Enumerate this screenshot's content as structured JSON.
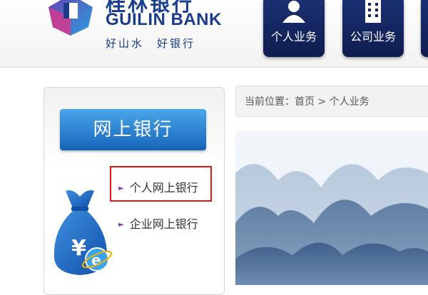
{
  "header": {
    "logo_cn": "桂林银行",
    "logo_en": "GUILIN BANK",
    "slogan": "好山水　好银行",
    "nav": [
      {
        "label": "个人业务",
        "icon": "person-icon"
      },
      {
        "label": "公司业务",
        "icon": "building-icon"
      }
    ]
  },
  "sidebar": {
    "title": "网上银行",
    "links": [
      {
        "label": "个人网上银行"
      },
      {
        "label": "企业网上银行"
      }
    ],
    "illustration": "money-bag-ie-icon"
  },
  "breadcrumb": {
    "text": "当前位置：首页 > 个人业务"
  },
  "banner": {
    "image": "mountain-landscape"
  },
  "colors": {
    "brand_blue": "#1b3b8c",
    "nav_navy": "#14265f",
    "button_blue": "#2f86d6",
    "highlight_red": "#e01515"
  }
}
